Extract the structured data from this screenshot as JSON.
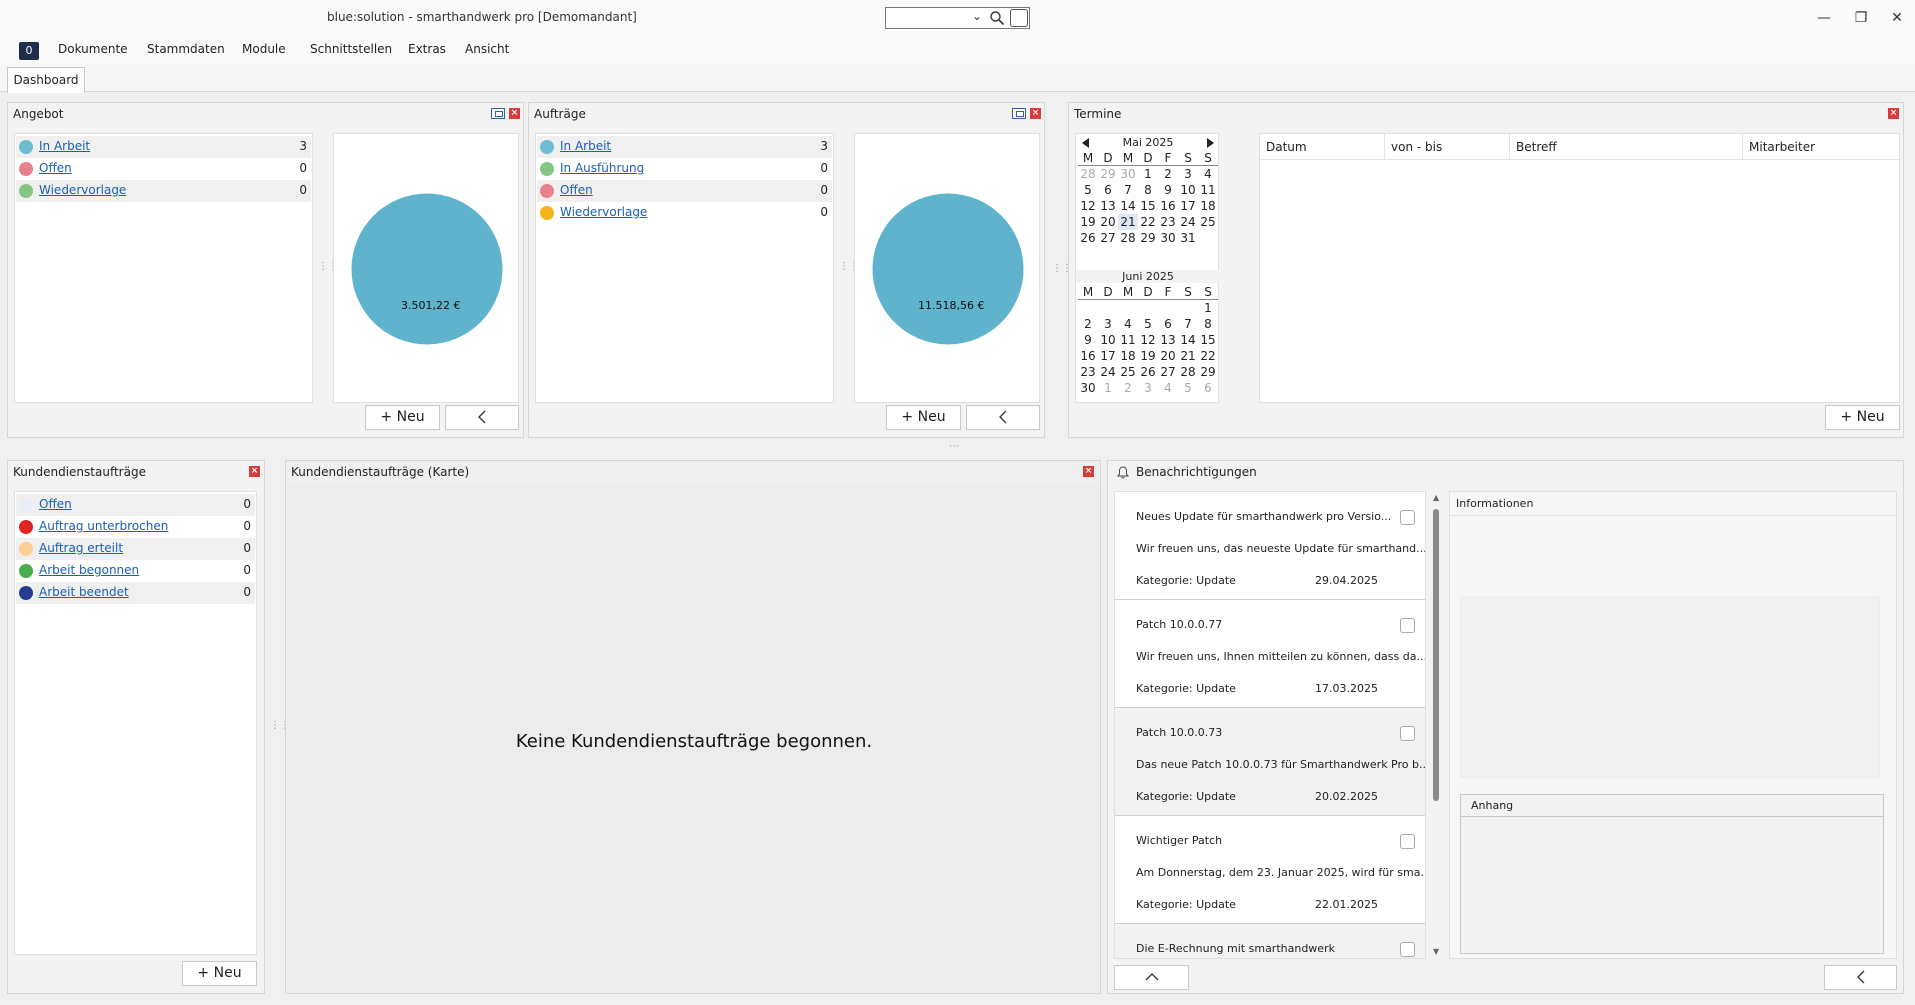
{
  "window": {
    "title": "blue:solution - smarthandwerk pro [Demomandant]",
    "search_value": "",
    "minimize": "—",
    "restore": "❐",
    "close": "✕"
  },
  "menu": {
    "badge": "0",
    "items": [
      "Dokumente",
      "Stammdaten",
      "Module",
      "Schnittstellen",
      "Extras",
      "Ansicht"
    ]
  },
  "tabs": [
    {
      "label": "Dashboard"
    }
  ],
  "angebot": {
    "title": "Angebot",
    "items": [
      {
        "label": "In Arbeit",
        "count": "3",
        "color": "#6cbcd2"
      },
      {
        "label": "Offen",
        "count": "0",
        "color": "#e9808e"
      },
      {
        "label": "Wiedervorlage",
        "count": "0",
        "color": "#86c685"
      }
    ],
    "chart_value": "3.501,22 €",
    "new_button": "+ Neu"
  },
  "auftraege": {
    "title": "Aufträge",
    "items": [
      {
        "label": "In Arbeit",
        "count": "3",
        "color": "#6cbcd2"
      },
      {
        "label": "In Ausführung",
        "count": "0",
        "color": "#86c685"
      },
      {
        "label": "Offen",
        "count": "0",
        "color": "#e9808e"
      },
      {
        "label": "Wiedervorlage",
        "count": "0",
        "color": "#f5b51a"
      }
    ],
    "chart_value": "11.518,56 €",
    "new_button": "+ Neu"
  },
  "termine": {
    "title": "Termine",
    "weekdays": [
      "M",
      "D",
      "M",
      "D",
      "F",
      "S",
      "S"
    ],
    "months": [
      {
        "name": "Mai 2025",
        "rows": [
          [
            "28",
            "29",
            "30",
            "1",
            "2",
            "3",
            "4"
          ],
          [
            "5",
            "6",
            "7",
            "8",
            "9",
            "10",
            "11"
          ],
          [
            "12",
            "13",
            "14",
            "15",
            "16",
            "17",
            "18"
          ],
          [
            "19",
            "20",
            "21",
            "22",
            "23",
            "24",
            "25"
          ],
          [
            "26",
            "27",
            "28",
            "29",
            "30",
            "31",
            ""
          ]
        ]
      },
      {
        "name": "Juni 2025",
        "rows": [
          [
            "",
            "",
            "",
            "",
            "",
            "",
            "1"
          ],
          [
            "2",
            "3",
            "4",
            "5",
            "6",
            "7",
            "8"
          ],
          [
            "9",
            "10",
            "11",
            "12",
            "13",
            "14",
            "15"
          ],
          [
            "16",
            "17",
            "18",
            "19",
            "20",
            "21",
            "22"
          ],
          [
            "23",
            "24",
            "25",
            "26",
            "27",
            "28",
            "29"
          ],
          [
            "30",
            "1",
            "2",
            "3",
            "4",
            "5",
            "6"
          ]
        ]
      }
    ],
    "columns": [
      "Datum",
      "von - bis",
      "Betreff",
      "Mitarbeiter"
    ],
    "new_button": "+ Neu"
  },
  "kundendienst": {
    "title": "Kundendienstaufträge",
    "items": [
      {
        "label": "Offen",
        "count": "0",
        "color": "#e8eef8"
      },
      {
        "label": "Auftrag unterbrochen",
        "count": "0",
        "color": "#e02424"
      },
      {
        "label": "Auftrag erteilt",
        "count": "0",
        "color": "#fbcf96"
      },
      {
        "label": "Arbeit begonnen",
        "count": "0",
        "color": "#4cad4c"
      },
      {
        "label": "Arbeit beendet",
        "count": "0",
        "color": "#243c8f"
      }
    ],
    "new_button": "+ Neu"
  },
  "karte": {
    "title": "Kundendienstaufträge (Karte)",
    "empty_text": "Keine Kundendienstaufträge begonnen."
  },
  "benachrichtigungen": {
    "title": "Benachrichtigungen",
    "items": [
      {
        "title": "Neues Update für smarthandwerk pro Versio...",
        "body": "Wir freuen uns, das neueste Update für smarthand...",
        "category": "Kategorie: Update",
        "date": "29.04.2025"
      },
      {
        "title": "Patch 10.0.0.77",
        "body": "Wir freuen uns, Ihnen mitteilen zu können, dass da...",
        "category": "Kategorie: Update",
        "date": "17.03.2025"
      },
      {
        "title": "Patch 10.0.0.73",
        "body": "Das neue Patch 10.0.0.73 für Smarthandwerk Pro b...",
        "category": "Kategorie: Update",
        "date": "20.02.2025"
      },
      {
        "title": "Wichtiger Patch",
        "body": "Am Donnerstag, dem 23. Januar 2025, wird für sma...",
        "category": "Kategorie: Update",
        "date": "22.01.2025"
      },
      {
        "title": "Die E-Rechnung mit smarthandwerk",
        "body": "",
        "category": "",
        "date": ""
      }
    ],
    "info_title": "Informationen",
    "attachment_title": "Anhang"
  }
}
